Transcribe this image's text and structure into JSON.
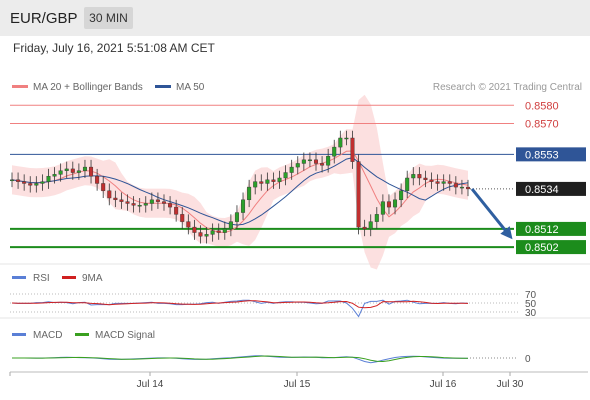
{
  "header": {
    "symbol": "EUR/GBP",
    "timeframe": "30 MIN"
  },
  "timestamp": "Friday, July 16, 2021 5:51:08 AM CET",
  "colors": {
    "bollinger": "#f08080",
    "bollinger_fill": "#fbd5d5",
    "ma50": "#2f5597",
    "resistance": "#f08080",
    "support": "#1c8c1c",
    "last": "#1f1f1f",
    "arrow": "#2f5fa0",
    "up_candle": "#2aa02a",
    "down_candle": "#c03030",
    "rsi": "#5a7fd6",
    "rsi_ma": "#d02020",
    "macd": "#5a7fd6",
    "macd_signal": "#3aa020"
  },
  "legend": {
    "ma20_bb": "MA 20 + Bollinger Bands",
    "ma50": "MA 50"
  },
  "copyright": "Research © 2021 Trading Central",
  "chart_data": {
    "type": "candlestick",
    "title": "EUR/GBP",
    "xlabel": "",
    "ylabel": "",
    "x_ticks": [
      "Jul 14",
      "Jul 15",
      "Jul 16",
      "Jul 30"
    ],
    "ylim": [
      0.8496,
      0.8584
    ],
    "close_series": [
      0.8539,
      0.8538,
      0.8537,
      0.8536,
      0.8537,
      0.8538,
      0.8541,
      0.8542,
      0.8544,
      0.8545,
      0.8543,
      0.8544,
      0.8546,
      0.8541,
      0.8537,
      0.8533,
      0.8529,
      0.8528,
      0.8527,
      0.8526,
      0.8525,
      0.8525,
      0.8526,
      0.8528,
      0.8527,
      0.8526,
      0.8524,
      0.852,
      0.8516,
      0.8513,
      0.851,
      0.8508,
      0.8509,
      0.8511,
      0.851,
      0.8512,
      0.8516,
      0.8521,
      0.8528,
      0.8535,
      0.8538,
      0.8537,
      0.8539,
      0.8538,
      0.854,
      0.8543,
      0.8546,
      0.8548,
      0.855,
      0.855,
      0.8548,
      0.8547,
      0.8552,
      0.8557,
      0.8562,
      0.8562,
      0.8549,
      0.8513,
      0.8512,
      0.8516,
      0.852,
      0.8527,
      0.8524,
      0.8528,
      0.8533,
      0.854,
      0.8542,
      0.854,
      0.8539,
      0.8538,
      0.8537,
      0.8538,
      0.8537,
      0.8535,
      0.8535,
      0.8534
    ],
    "levels": [
      {
        "value": 0.858,
        "label": "0.8580",
        "kind": "resistance"
      },
      {
        "value": 0.857,
        "label": "0.8570",
        "kind": "resistance"
      },
      {
        "value": 0.8553,
        "label": "0.8553",
        "kind": "ma50"
      },
      {
        "value": 0.8534,
        "label": "0.8534",
        "kind": "last"
      },
      {
        "value": 0.8512,
        "label": "0.8512",
        "kind": "support"
      },
      {
        "value": 0.8502,
        "label": "0.8502",
        "kind": "support"
      }
    ],
    "forecast_arrow": {
      "from": 0.8534,
      "to": 0.8508
    },
    "rsi": {
      "legend": [
        "RSI",
        "9MA"
      ],
      "levels": [
        "70",
        "50",
        "30"
      ]
    },
    "macd": {
      "legend": [
        "MACD",
        "MACD Signal"
      ],
      "zero_label": "0"
    }
  }
}
